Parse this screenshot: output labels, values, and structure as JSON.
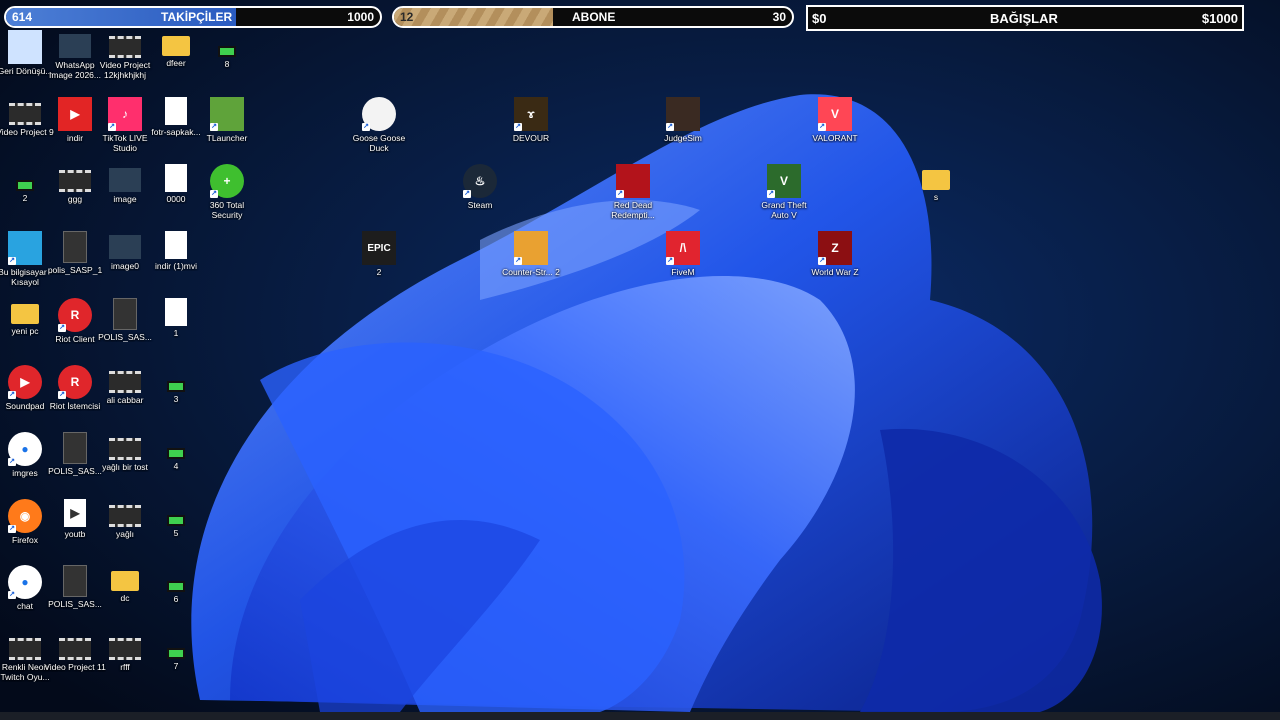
{
  "followers": {
    "current": "614",
    "label": "TAKİPÇİLER",
    "goal": "1000",
    "progress": 0.614
  },
  "subscribers": {
    "current": "12",
    "label": "ABONE",
    "goal": "30",
    "progress": 0.4
  },
  "donations": {
    "current": "$0",
    "label": "BAĞIŞLAR",
    "goal": "$1000"
  },
  "desktop_icons": [
    {
      "label": "Geri Dönüşü...",
      "icon": "recycle-bin-icon"
    },
    {
      "label": "WhatsApp Image 2026...",
      "icon": "image-thumbnail-icon"
    },
    {
      "label": "Video Project 12kjhkhjkhj",
      "icon": "video-file-icon"
    },
    {
      "label": "dfeer",
      "icon": "folder-icon"
    },
    {
      "label": "8",
      "icon": "green-file-icon"
    },
    {
      "label": "Video Project 9",
      "icon": "video-file-icon"
    },
    {
      "label": "indir",
      "icon": "youtube-icon"
    },
    {
      "label": "TikTok LIVE Studio",
      "icon": "tiktok-icon"
    },
    {
      "label": "fotr-sapkak...",
      "icon": "hat-image-icon"
    },
    {
      "label": "TLauncher",
      "icon": "minecraft-icon"
    },
    {
      "label": "2",
      "icon": "green-file-icon"
    },
    {
      "label": "ggg",
      "icon": "video-file-icon"
    },
    {
      "label": "image",
      "icon": "image-thumbnail-icon"
    },
    {
      "label": "0000",
      "icon": "image-file-icon"
    },
    {
      "label": "360 Total Security",
      "icon": "security-icon"
    },
    {
      "label": "Bu bilgisayar - Kısayol",
      "icon": "monitor-icon"
    },
    {
      "label": "polis_SASP_1",
      "icon": "document-icon"
    },
    {
      "label": "image0",
      "icon": "image-thumbnail-icon"
    },
    {
      "label": "indir (1)mvi",
      "icon": "hat-image-icon"
    },
    {
      "label": "yeni pc",
      "icon": "folder-icon"
    },
    {
      "label": "Riot Client",
      "icon": "riot-icon"
    },
    {
      "label": "POLIS_SAS...",
      "icon": "document-icon"
    },
    {
      "label": "1",
      "icon": "image-file-icon"
    },
    {
      "label": "Soundpad",
      "icon": "soundpad-icon"
    },
    {
      "label": "Riot İstemcisi",
      "icon": "riot-icon"
    },
    {
      "label": "ali cabbar",
      "icon": "video-file-icon"
    },
    {
      "label": "3",
      "icon": "green-file-icon"
    },
    {
      "label": "imgres",
      "icon": "chrome-icon"
    },
    {
      "label": "POLIS_SAS...",
      "icon": "document-icon"
    },
    {
      "label": "yağlı bir tost",
      "icon": "video-file-icon"
    },
    {
      "label": "4",
      "icon": "green-file-icon"
    },
    {
      "label": "Firefox",
      "icon": "firefox-icon"
    },
    {
      "label": "youtb",
      "icon": "media-file-icon"
    },
    {
      "label": "yağlı",
      "icon": "video-file-icon"
    },
    {
      "label": "5",
      "icon": "green-file-icon"
    },
    {
      "label": "chat",
      "icon": "chrome-icon"
    },
    {
      "label": "POLIS_SAS...",
      "icon": "document-icon"
    },
    {
      "label": "dc",
      "icon": "folder-icon"
    },
    {
      "label": "6",
      "icon": "green-file-icon"
    },
    {
      "label": "Renkli Neon Twitch Oyu...",
      "icon": "video-file-icon"
    },
    {
      "label": "Video Project 11",
      "icon": "video-file-icon"
    },
    {
      "label": "rfff",
      "icon": "video-file-icon"
    },
    {
      "label": "7",
      "icon": "green-file-icon"
    },
    {
      "label": "Goose Goose Duck",
      "icon": "goose-icon"
    },
    {
      "label": "DEVOUR",
      "icon": "devour-icon"
    },
    {
      "label": "JudgeSim",
      "icon": "judgesim-icon"
    },
    {
      "label": "VALORANT",
      "icon": "valorant-icon"
    },
    {
      "label": "Steam",
      "icon": "steam-icon"
    },
    {
      "label": "Red Dead Redempti...",
      "icon": "rdr-icon"
    },
    {
      "label": "Grand Theft Auto V",
      "icon": "gta-icon"
    },
    {
      "label": "s",
      "icon": "folder-icon"
    },
    {
      "label": "2",
      "icon": "epic-games-icon"
    },
    {
      "label": "Counter-Str... 2",
      "icon": "cs-icon"
    },
    {
      "label": "FiveM",
      "icon": "fivem-icon"
    },
    {
      "label": "World War Z",
      "icon": "wwz-icon"
    }
  ],
  "colors": {
    "wallpaper_dark": "#06142e",
    "bloom_blue": "#1f4fe8",
    "bloom_light": "#5f8dff"
  }
}
